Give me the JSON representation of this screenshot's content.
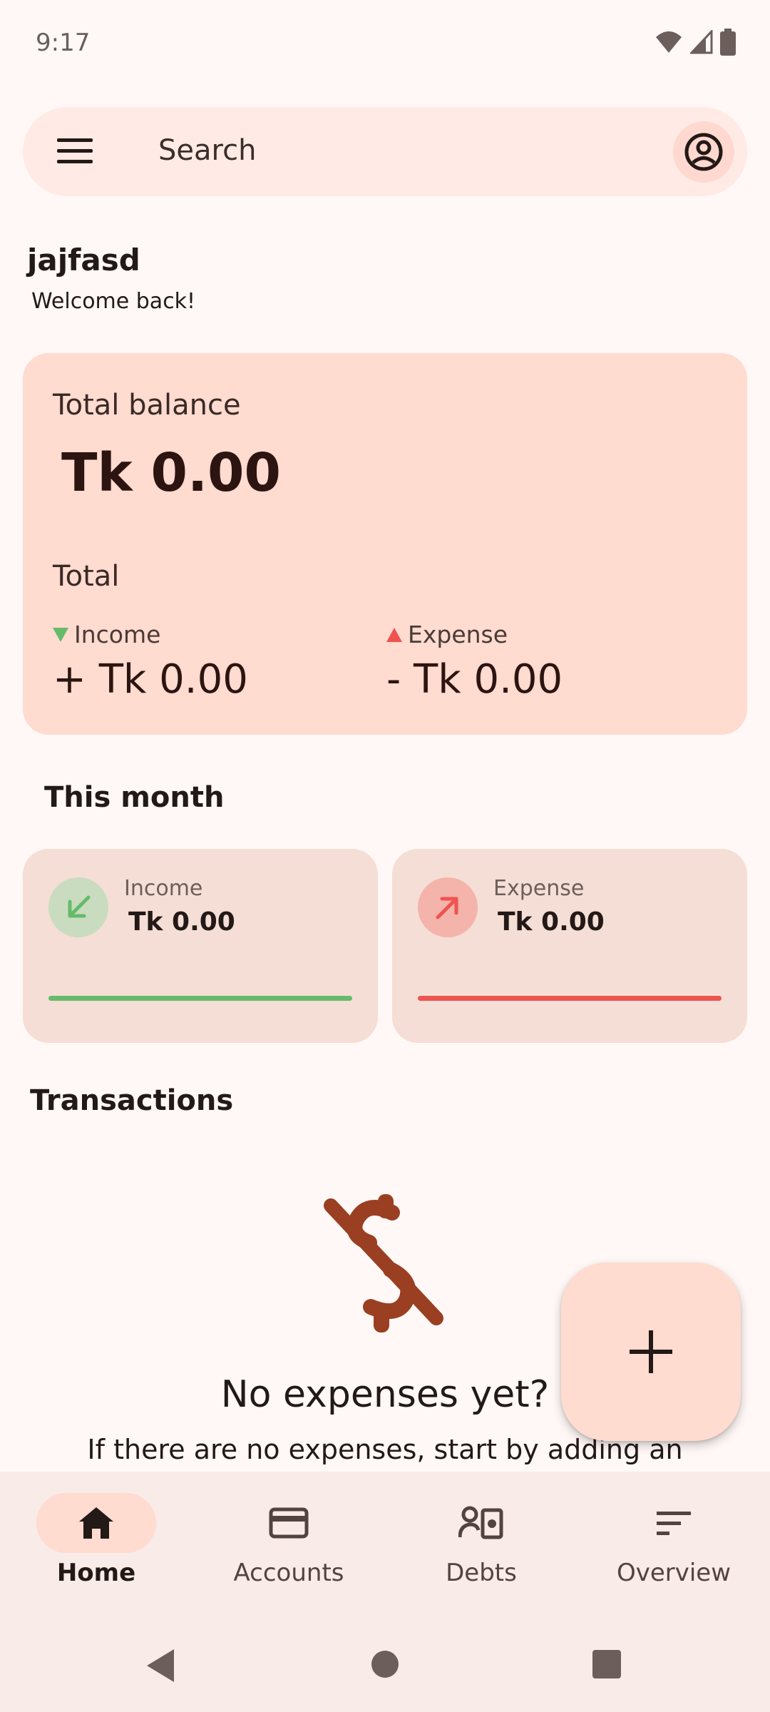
{
  "status_bar": {
    "time": "9:17"
  },
  "search": {
    "label": "Search"
  },
  "greeting": {
    "username": "jajfasd",
    "subtitle": "Welcome back!"
  },
  "balance_card": {
    "title": "Total balance",
    "amount": "Tk 0.00",
    "section_label": "Total",
    "income_label": "Income",
    "income_amount": "+ Tk 0.00",
    "expense_label": "Expense",
    "expense_amount": "- Tk 0.00"
  },
  "this_month": {
    "heading": "This month",
    "income": {
      "label": "Income",
      "amount": "Tk 0.00"
    },
    "expense": {
      "label": "Expense",
      "amount": "Tk 0.00"
    }
  },
  "transactions": {
    "heading": "Transactions",
    "empty_title": "No expenses yet?",
    "empty_text": "If there are no expenses, start by adding an"
  },
  "bottom_nav": {
    "items": [
      {
        "label": "Home",
        "icon": "home-icon",
        "active": true
      },
      {
        "label": "Accounts",
        "icon": "credit-card-icon",
        "active": false
      },
      {
        "label": "Debts",
        "icon": "debts-icon",
        "active": false
      },
      {
        "label": "Overview",
        "icon": "sort-icon",
        "active": false
      }
    ]
  },
  "colors": {
    "background": "#fff8f7",
    "card": "#ffdbd0",
    "mini_card": "#f5ded5",
    "income_green": "#66bb6a",
    "expense_red": "#ef5350",
    "brand_brown": "#9a3f22"
  }
}
